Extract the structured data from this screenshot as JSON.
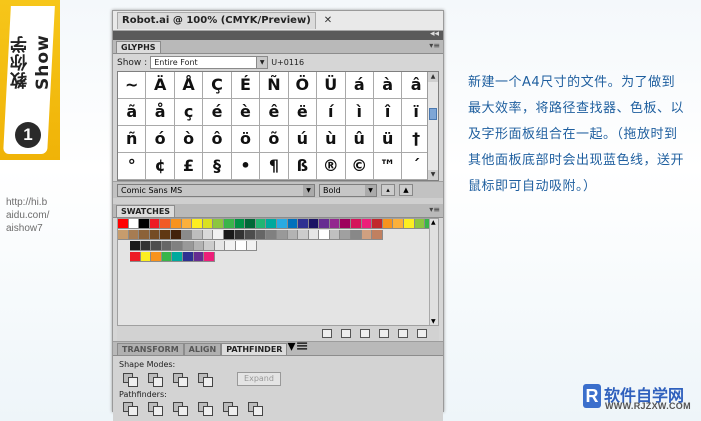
{
  "side": {
    "brand": "教你学Show",
    "step": "1",
    "url_lines": [
      "http://hi.b",
      "aidu.com/",
      "aishow7"
    ]
  },
  "window": {
    "title": "Robot.ai @ 100% (CMYK/Preview)",
    "close": "✕"
  },
  "glyphs": {
    "tab": "GLYPHS",
    "show_label": "Show :",
    "show_value": "Entire Font",
    "unicode": "U+0116",
    "rows": [
      [
        "~",
        "Ä",
        "Å",
        "Ç",
        "É",
        "Ñ",
        "Ö",
        "Ü",
        "á",
        "à",
        "â"
      ],
      [
        "ã",
        "å",
        "ç",
        "é",
        "è",
        "ê",
        "ë",
        "í",
        "ì",
        "î",
        "ï"
      ],
      [
        "ñ",
        "ó",
        "ò",
        "ô",
        "ö",
        "õ",
        "ú",
        "ù",
        "û",
        "ü",
        "†"
      ],
      [
        "°",
        "¢",
        "£",
        "§",
        "•",
        "¶",
        "ß",
        "®",
        "©",
        "™",
        "´"
      ]
    ],
    "font": "Comic Sans MS",
    "style": "Bold"
  },
  "swatches": {
    "tab": "SWATCHES",
    "row1": [
      "#ff0000",
      "#ffffff",
      "#000000",
      "#ed1c24",
      "#f15a24",
      "#f7931e",
      "#fbb03b",
      "#fcee21",
      "#d9e021",
      "#8cc63f",
      "#39b54a",
      "#009245",
      "#006837",
      "#22b573",
      "#00a99d",
      "#29abe2",
      "#0071bc",
      "#2e3192",
      "#1b1464",
      "#662d91",
      "#93278f",
      "#9e005d",
      "#d4145a",
      "#ed1e79",
      "#c1272d",
      "#f7931e",
      "#fbb03b",
      "#fcee21",
      "#8cc63f",
      "#39b54a"
    ],
    "row2": [
      "#c69c6d",
      "#a67c52",
      "#8c6239",
      "#754c24",
      "#603813",
      "#42210b",
      "#8b8b8b",
      "#bdbdbd",
      "#d9d9d9",
      "#f2f2f2",
      "#1a1a1a",
      "#333333",
      "#4d4d4d",
      "#666666",
      "#808080",
      "#999999",
      "#b3b3b3",
      "#cccccc",
      "#e6e6e6",
      "#ffffff",
      "#c0c0c0",
      "#a0a0a0",
      "#888888",
      "#d0a080",
      "#c08060"
    ],
    "row3": [
      "#1a1a1a",
      "#333333",
      "#4d4d4d",
      "#666666",
      "#808080",
      "#999999",
      "#b3b3b3",
      "#cccccc",
      "#e6e6e6",
      "#f2f2f2",
      "#ffffff",
      "#f2f2f2"
    ],
    "row4": [
      "#ed1c24",
      "#fcee21",
      "#f7931e",
      "#39b54a",
      "#00a99d",
      "#2e3192",
      "#662d91",
      "#ed1e79"
    ]
  },
  "pathfinder": {
    "tabs": [
      "TRANSFORM",
      "ALIGN",
      "PATHFINDER"
    ],
    "shape_modes": "Shape Modes:",
    "expand": "Expand",
    "pathfinders": "Pathfinders:"
  },
  "instruction": "新建一个A4尺寸的文件。为了做到最大效率，将路径查找器、色板、以及字形面板组合在一起。（拖放时到其他面板底部时会出现蓝色线，送开鼠标即可自动吸附。）",
  "logo": {
    "mark": "R",
    "name": "软件自学网",
    "site": "WWW.RJZXW.COM"
  }
}
